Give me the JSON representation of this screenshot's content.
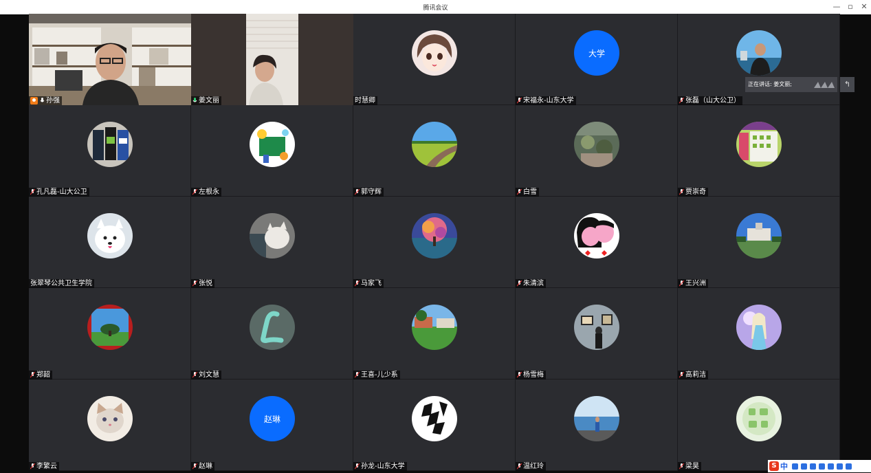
{
  "window": {
    "title": "腾讯会议"
  },
  "speaker": {
    "label": "正在讲话: 姜文丽;"
  },
  "participants": [
    {
      "name": "孙强",
      "type": "video",
      "host": true
    },
    {
      "name": "姜文丽",
      "type": "video",
      "speaking": true
    },
    {
      "name": "时慧卿",
      "type": "avatar",
      "avatar_icon": "anime-girl-avatar",
      "mic": false
    },
    {
      "name": "宋福永-山东大学",
      "type": "text-avatar",
      "avatar_text": "大学",
      "avatar_color": "#0a6cff"
    },
    {
      "name": "张磊（山大公卫）",
      "type": "avatar",
      "avatar_icon": "person-boat-avatar"
    },
    {
      "name": "孔凡磊-山大公卫",
      "type": "avatar",
      "avatar_icon": "drink-cans-avatar"
    },
    {
      "name": "左根永",
      "type": "avatar",
      "avatar_icon": "cartoon-board-avatar"
    },
    {
      "name": "郭守辉",
      "type": "avatar",
      "avatar_icon": "road-field-avatar"
    },
    {
      "name": "白雪",
      "type": "avatar",
      "avatar_icon": "garden-avatar"
    },
    {
      "name": "贾崇奇",
      "type": "avatar",
      "avatar_icon": "calendar-avatar"
    },
    {
      "name": "张翠琴公共卫生学院",
      "type": "avatar",
      "avatar_icon": "white-dog-avatar",
      "mic": false
    },
    {
      "name": "张悦",
      "type": "avatar",
      "avatar_icon": "cat-avatar"
    },
    {
      "name": "马家飞",
      "type": "avatar",
      "avatar_icon": "colorful-tree-avatar"
    },
    {
      "name": "朱清滨",
      "type": "avatar",
      "avatar_icon": "cartoon-couple-avatar"
    },
    {
      "name": "王兴洲",
      "type": "avatar",
      "avatar_icon": "building-avatar"
    },
    {
      "name": "郑韶",
      "type": "avatar",
      "avatar_icon": "tree-landscape-avatar"
    },
    {
      "name": "刘文慧",
      "type": "avatar",
      "avatar_icon": "letter-l-avatar"
    },
    {
      "name": "王喜-儿少系",
      "type": "avatar",
      "avatar_icon": "campus-avatar"
    },
    {
      "name": "杨雪梅",
      "type": "avatar",
      "avatar_icon": "gallery-avatar"
    },
    {
      "name": "高莉洁",
      "type": "avatar",
      "avatar_icon": "princess-avatar"
    },
    {
      "name": "李繁云",
      "type": "avatar",
      "avatar_icon": "kitten-avatar"
    },
    {
      "name": "赵琳",
      "type": "text-avatar",
      "avatar_text": "赵琳",
      "avatar_color": "#0a6cff"
    },
    {
      "name": "孙龙-山东大学",
      "type": "avatar",
      "avatar_icon": "calligraphy-dragon-avatar"
    },
    {
      "name": "温红玲",
      "type": "avatar",
      "avatar_icon": "seaside-avatar"
    },
    {
      "name": "梁昊",
      "type": "avatar",
      "avatar_icon": "green-text-avatar"
    }
  ],
  "ime_bar": {
    "logo": "S",
    "mode": "中"
  }
}
